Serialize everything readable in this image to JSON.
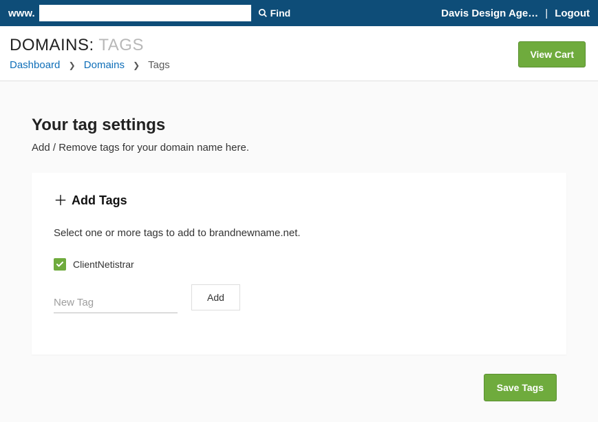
{
  "topbar": {
    "www_label": "www.",
    "search_value": "",
    "find_label": "Find",
    "account_name": "Davis Design Age…",
    "logout_label": "Logout"
  },
  "header": {
    "title_strong": "DOMAINS:",
    "title_muted": "TAGS",
    "breadcrumb": {
      "dashboard": "Dashboard",
      "domains": "Domains",
      "current": "Tags"
    },
    "view_cart_label": "View Cart"
  },
  "section": {
    "title": "Your tag settings",
    "subtitle": "Add / Remove tags for your domain name here."
  },
  "card": {
    "add_tags_label": "Add Tags",
    "description": "Select one or more tags to add to brandnewname.net.",
    "tags": [
      {
        "label": "ClientNetistrar",
        "checked": true
      }
    ],
    "new_tag_placeholder": "New Tag",
    "add_button_label": "Add"
  },
  "footer": {
    "save_label": "Save Tags"
  }
}
